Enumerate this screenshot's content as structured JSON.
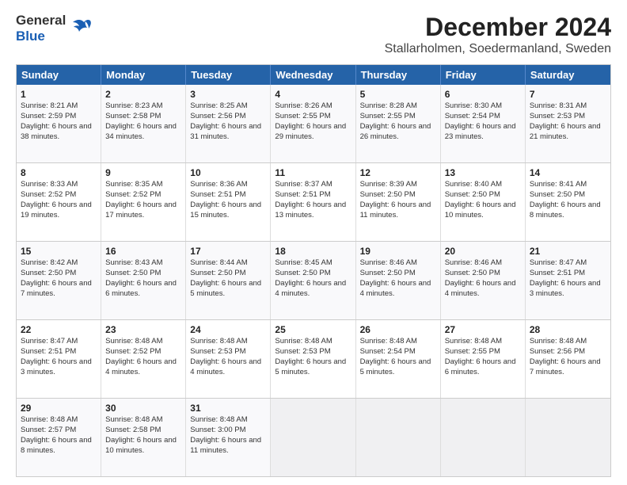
{
  "header": {
    "logo_general": "General",
    "logo_blue": "Blue",
    "title": "December 2024",
    "subtitle": "Stallarholmen, Soedermanland, Sweden"
  },
  "days_of_week": [
    "Sunday",
    "Monday",
    "Tuesday",
    "Wednesday",
    "Thursday",
    "Friday",
    "Saturday"
  ],
  "weeks": [
    [
      {
        "day": "1",
        "sunrise": "Sunrise: 8:21 AM",
        "sunset": "Sunset: 2:59 PM",
        "daylight": "Daylight: 6 hours and 38 minutes."
      },
      {
        "day": "2",
        "sunrise": "Sunrise: 8:23 AM",
        "sunset": "Sunset: 2:58 PM",
        "daylight": "Daylight: 6 hours and 34 minutes."
      },
      {
        "day": "3",
        "sunrise": "Sunrise: 8:25 AM",
        "sunset": "Sunset: 2:56 PM",
        "daylight": "Daylight: 6 hours and 31 minutes."
      },
      {
        "day": "4",
        "sunrise": "Sunrise: 8:26 AM",
        "sunset": "Sunset: 2:55 PM",
        "daylight": "Daylight: 6 hours and 29 minutes."
      },
      {
        "day": "5",
        "sunrise": "Sunrise: 8:28 AM",
        "sunset": "Sunset: 2:55 PM",
        "daylight": "Daylight: 6 hours and 26 minutes."
      },
      {
        "day": "6",
        "sunrise": "Sunrise: 8:30 AM",
        "sunset": "Sunset: 2:54 PM",
        "daylight": "Daylight: 6 hours and 23 minutes."
      },
      {
        "day": "7",
        "sunrise": "Sunrise: 8:31 AM",
        "sunset": "Sunset: 2:53 PM",
        "daylight": "Daylight: 6 hours and 21 minutes."
      }
    ],
    [
      {
        "day": "8",
        "sunrise": "Sunrise: 8:33 AM",
        "sunset": "Sunset: 2:52 PM",
        "daylight": "Daylight: 6 hours and 19 minutes."
      },
      {
        "day": "9",
        "sunrise": "Sunrise: 8:35 AM",
        "sunset": "Sunset: 2:52 PM",
        "daylight": "Daylight: 6 hours and 17 minutes."
      },
      {
        "day": "10",
        "sunrise": "Sunrise: 8:36 AM",
        "sunset": "Sunset: 2:51 PM",
        "daylight": "Daylight: 6 hours and 15 minutes."
      },
      {
        "day": "11",
        "sunrise": "Sunrise: 8:37 AM",
        "sunset": "Sunset: 2:51 PM",
        "daylight": "Daylight: 6 hours and 13 minutes."
      },
      {
        "day": "12",
        "sunrise": "Sunrise: 8:39 AM",
        "sunset": "Sunset: 2:50 PM",
        "daylight": "Daylight: 6 hours and 11 minutes."
      },
      {
        "day": "13",
        "sunrise": "Sunrise: 8:40 AM",
        "sunset": "Sunset: 2:50 PM",
        "daylight": "Daylight: 6 hours and 10 minutes."
      },
      {
        "day": "14",
        "sunrise": "Sunrise: 8:41 AM",
        "sunset": "Sunset: 2:50 PM",
        "daylight": "Daylight: 6 hours and 8 minutes."
      }
    ],
    [
      {
        "day": "15",
        "sunrise": "Sunrise: 8:42 AM",
        "sunset": "Sunset: 2:50 PM",
        "daylight": "Daylight: 6 hours and 7 minutes."
      },
      {
        "day": "16",
        "sunrise": "Sunrise: 8:43 AM",
        "sunset": "Sunset: 2:50 PM",
        "daylight": "Daylight: 6 hours and 6 minutes."
      },
      {
        "day": "17",
        "sunrise": "Sunrise: 8:44 AM",
        "sunset": "Sunset: 2:50 PM",
        "daylight": "Daylight: 6 hours and 5 minutes."
      },
      {
        "day": "18",
        "sunrise": "Sunrise: 8:45 AM",
        "sunset": "Sunset: 2:50 PM",
        "daylight": "Daylight: 6 hours and 4 minutes."
      },
      {
        "day": "19",
        "sunrise": "Sunrise: 8:46 AM",
        "sunset": "Sunset: 2:50 PM",
        "daylight": "Daylight: 6 hours and 4 minutes."
      },
      {
        "day": "20",
        "sunrise": "Sunrise: 8:46 AM",
        "sunset": "Sunset: 2:50 PM",
        "daylight": "Daylight: 6 hours and 4 minutes."
      },
      {
        "day": "21",
        "sunrise": "Sunrise: 8:47 AM",
        "sunset": "Sunset: 2:51 PM",
        "daylight": "Daylight: 6 hours and 3 minutes."
      }
    ],
    [
      {
        "day": "22",
        "sunrise": "Sunrise: 8:47 AM",
        "sunset": "Sunset: 2:51 PM",
        "daylight": "Daylight: 6 hours and 3 minutes."
      },
      {
        "day": "23",
        "sunrise": "Sunrise: 8:48 AM",
        "sunset": "Sunset: 2:52 PM",
        "daylight": "Daylight: 6 hours and 4 minutes."
      },
      {
        "day": "24",
        "sunrise": "Sunrise: 8:48 AM",
        "sunset": "Sunset: 2:53 PM",
        "daylight": "Daylight: 6 hours and 4 minutes."
      },
      {
        "day": "25",
        "sunrise": "Sunrise: 8:48 AM",
        "sunset": "Sunset: 2:53 PM",
        "daylight": "Daylight: 6 hours and 5 minutes."
      },
      {
        "day": "26",
        "sunrise": "Sunrise: 8:48 AM",
        "sunset": "Sunset: 2:54 PM",
        "daylight": "Daylight: 6 hours and 5 minutes."
      },
      {
        "day": "27",
        "sunrise": "Sunrise: 8:48 AM",
        "sunset": "Sunset: 2:55 PM",
        "daylight": "Daylight: 6 hours and 6 minutes."
      },
      {
        "day": "28",
        "sunrise": "Sunrise: 8:48 AM",
        "sunset": "Sunset: 2:56 PM",
        "daylight": "Daylight: 6 hours and 7 minutes."
      }
    ],
    [
      {
        "day": "29",
        "sunrise": "Sunrise: 8:48 AM",
        "sunset": "Sunset: 2:57 PM",
        "daylight": "Daylight: 6 hours and 8 minutes."
      },
      {
        "day": "30",
        "sunrise": "Sunrise: 8:48 AM",
        "sunset": "Sunset: 2:58 PM",
        "daylight": "Daylight: 6 hours and 10 minutes."
      },
      {
        "day": "31",
        "sunrise": "Sunrise: 8:48 AM",
        "sunset": "Sunset: 3:00 PM",
        "daylight": "Daylight: 6 hours and 11 minutes."
      },
      null,
      null,
      null,
      null
    ]
  ]
}
